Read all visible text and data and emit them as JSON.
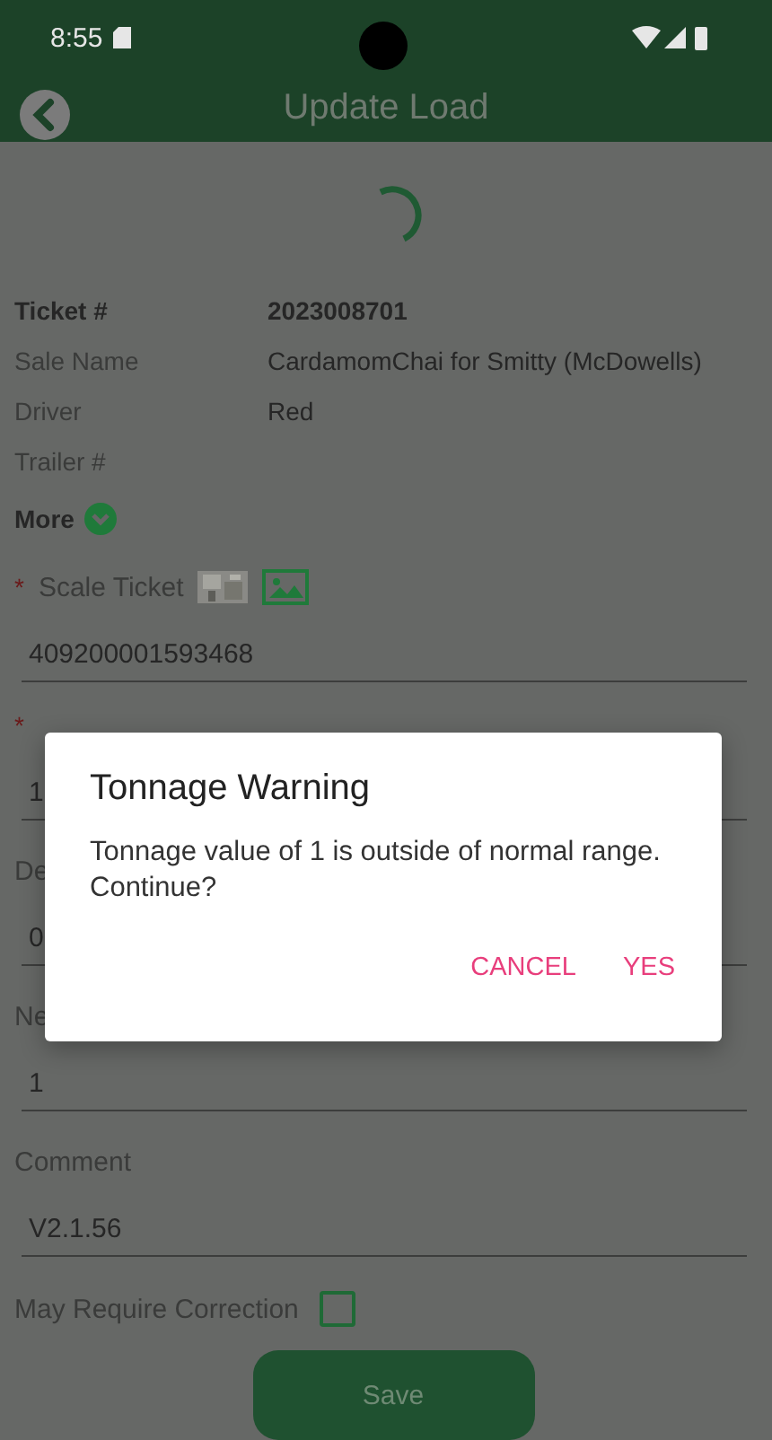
{
  "status_bar": {
    "time": "8:55"
  },
  "header": {
    "title": "Update Load"
  },
  "details": [
    {
      "label": "Ticket #",
      "value": "2023008701",
      "bold": true
    },
    {
      "label": "Sale Name",
      "value": "CardamomChai for Smitty (McDowells)",
      "bold": false
    },
    {
      "label": "Driver",
      "value": "Red",
      "bold": false
    },
    {
      "label": "Trailer #",
      "bold": false
    }
  ],
  "more": {
    "label": "More",
    "expanded": false
  },
  "scale_ticket": {
    "marker": "*",
    "label": "Scale Ticket",
    "value": "409200001593468"
  },
  "fields": [
    {
      "marker": "*",
      "value": "1"
    },
    {
      "label": "De",
      "value": "0"
    },
    {
      "label": "Ne",
      "value": "1"
    },
    {
      "label": "Comment",
      "value": "V2.1.56"
    }
  ],
  "correction": {
    "label": "May Require Correction",
    "checked": false
  },
  "save_button": "Save",
  "dialog": {
    "title": "Tonnage Warning",
    "message": "Tonnage value of 1 is outside of normal range. Continue?",
    "buttons": [
      "CANCEL",
      "YES"
    ]
  }
}
